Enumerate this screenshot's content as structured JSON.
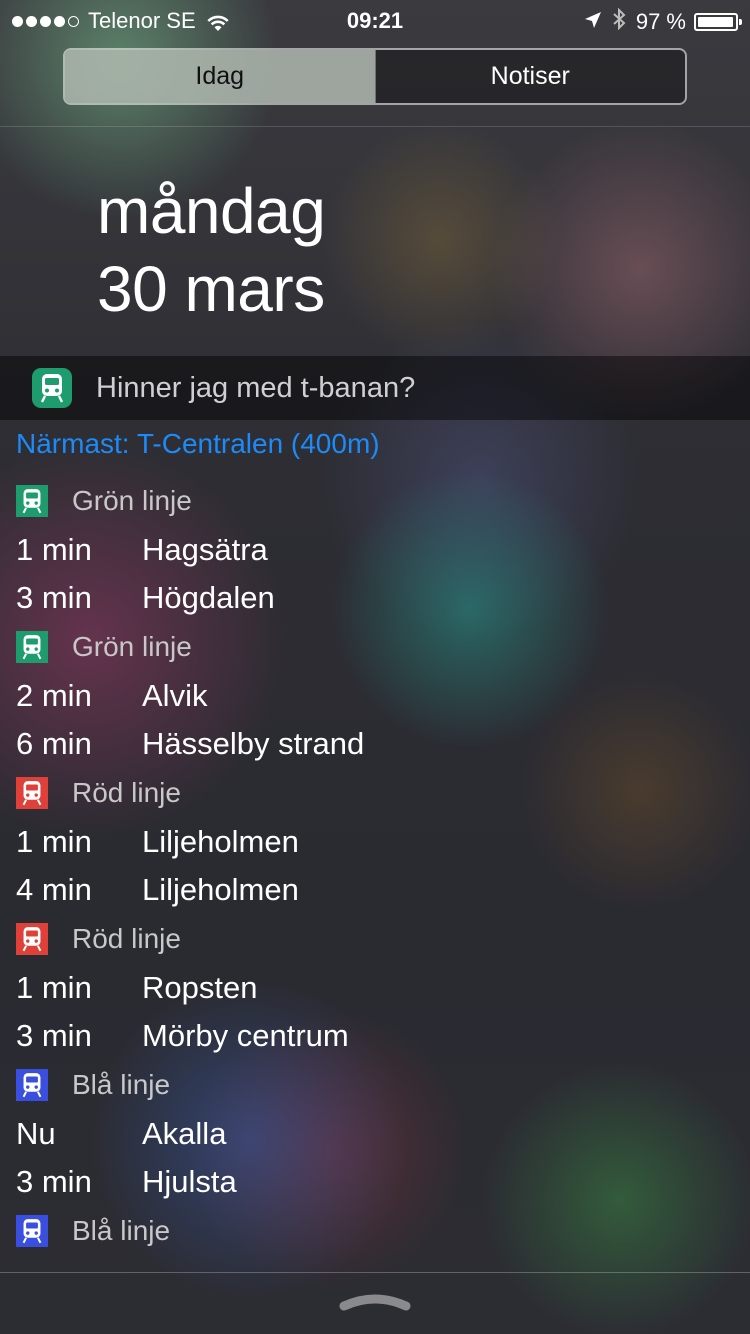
{
  "status_bar": {
    "carrier": "Telenor SE",
    "time": "09:21",
    "battery_percent": "97 %"
  },
  "tabs": [
    {
      "label": "Idag"
    },
    {
      "label": "Notiser"
    }
  ],
  "date": {
    "weekday": "måndag",
    "day_month": "30 mars"
  },
  "widget": {
    "title": "Hinner jag med t-banan?",
    "nearest": "Närmast: T-Centralen (400m)",
    "lines": [
      {
        "name": "Grön linje",
        "color": "#1f9c6e",
        "departures": [
          {
            "time": "1 min",
            "destination": "Hagsätra"
          },
          {
            "time": "3 min",
            "destination": "Högdalen"
          }
        ]
      },
      {
        "name": "Grön linje",
        "color": "#1f9c6e",
        "departures": [
          {
            "time": "2 min",
            "destination": "Alvik"
          },
          {
            "time": "6 min",
            "destination": "Hässelby strand"
          }
        ]
      },
      {
        "name": "Röd linje",
        "color": "#e0403a",
        "departures": [
          {
            "time": "1 min",
            "destination": "Liljeholmen"
          },
          {
            "time": "4 min",
            "destination": "Liljeholmen"
          }
        ]
      },
      {
        "name": "Röd linje",
        "color": "#e0403a",
        "departures": [
          {
            "time": "1 min",
            "destination": "Ropsten"
          },
          {
            "time": "3 min",
            "destination": "Mörby centrum"
          }
        ]
      },
      {
        "name": "Blå linje",
        "color": "#3a4fe0",
        "departures": [
          {
            "time": "Nu",
            "destination": "Akalla"
          },
          {
            "time": "3 min",
            "destination": "Hjulsta"
          }
        ]
      },
      {
        "name": "Blå linje",
        "color": "#3a4fe0",
        "departures": []
      }
    ]
  },
  "icons": {
    "signal": "signal-dots-icon",
    "wifi": "wifi-icon",
    "location": "location-arrow-icon",
    "bluetooth": "bluetooth-icon",
    "battery": "battery-icon",
    "train": "train-icon",
    "grabber": "chevron-up-grabber-icon"
  }
}
